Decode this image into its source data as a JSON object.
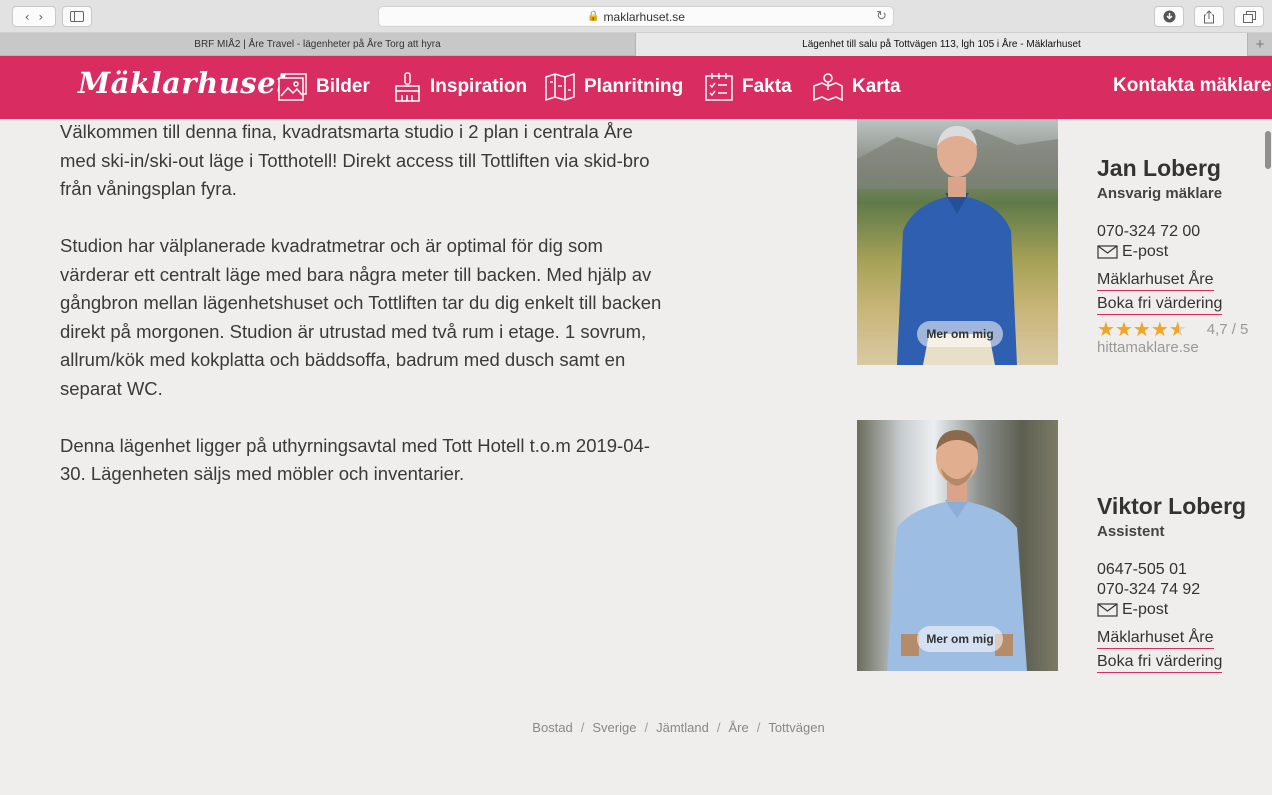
{
  "browser": {
    "address": "maklarhuset.se",
    "tabs": [
      {
        "title": "BRF MIÅ2 | Åre Travel - lägenheter på Åre Torg att hyra",
        "active": false
      },
      {
        "title": "Lägenhet till salu på Tottvägen 113, lgh 105 i Åre - Mäklarhuset",
        "active": true
      }
    ],
    "new_tab": "+"
  },
  "nav": {
    "logo": "Mäklarhuset",
    "items": [
      {
        "label": "Bilder",
        "icon": "images-icon"
      },
      {
        "label": "Inspiration",
        "icon": "paintbrush-icon"
      },
      {
        "label": "Planritning",
        "icon": "floorplan-icon"
      },
      {
        "label": "Fakta",
        "icon": "checklist-icon"
      },
      {
        "label": "Karta",
        "icon": "map-pin-icon"
      }
    ],
    "contact": "Kontakta mäklaren",
    "brand_color": "#d92c61"
  },
  "description": {
    "paragraphs": [
      "Välkommen till denna fina, kvadratsmarta studio i 2 plan i centrala Åre med ski-in/ski-out läge i Totthotell! Direkt access till Tottliften via skid-bro från våningsplan fyra.",
      "Studion har välplanerade kvadratmetrar och är optimal för dig som värderar ett centralt läge med bara några meter till backen. Med hjälp av gångbron mellan lägenhetshuset och Tottliften tar du dig enkelt till backen direkt på morgonen. Studion är utrustad med två rum i etage. 1 sovrum, allrum/kök med kokplatta och bäddsoffa, badrum med dusch samt en separat WC.",
      "Denna lägenhet ligger på uthyrningsavtal med Tott Hotell t.o.m 2019-04-30. Lägenheten säljs med möbler och inventarier."
    ]
  },
  "agents": [
    {
      "name": "Jan Loberg",
      "role": "Ansvarig mäklare",
      "phones": [
        "070-324 72 00"
      ],
      "email_label": "E-post",
      "office_link": "Mäklarhuset Åre",
      "valuation_link": "Boka fri värdering",
      "more_button": "Mer om mig",
      "rating": 4.7,
      "rating_text": "4,7 / 5",
      "rating_source": "hittamaklare.se"
    },
    {
      "name": "Viktor Loberg",
      "role": "Assistent",
      "phones": [
        "0647-505 01",
        "070-324 74 92"
      ],
      "email_label": "E-post",
      "office_link": "Mäklarhuset Åre",
      "valuation_link": "Boka fri värdering",
      "more_button": "Mer om mig"
    }
  ],
  "breadcrumb": [
    "Bostad",
    "Sverige",
    "Jämtland",
    "Åre",
    "Tottvägen"
  ]
}
